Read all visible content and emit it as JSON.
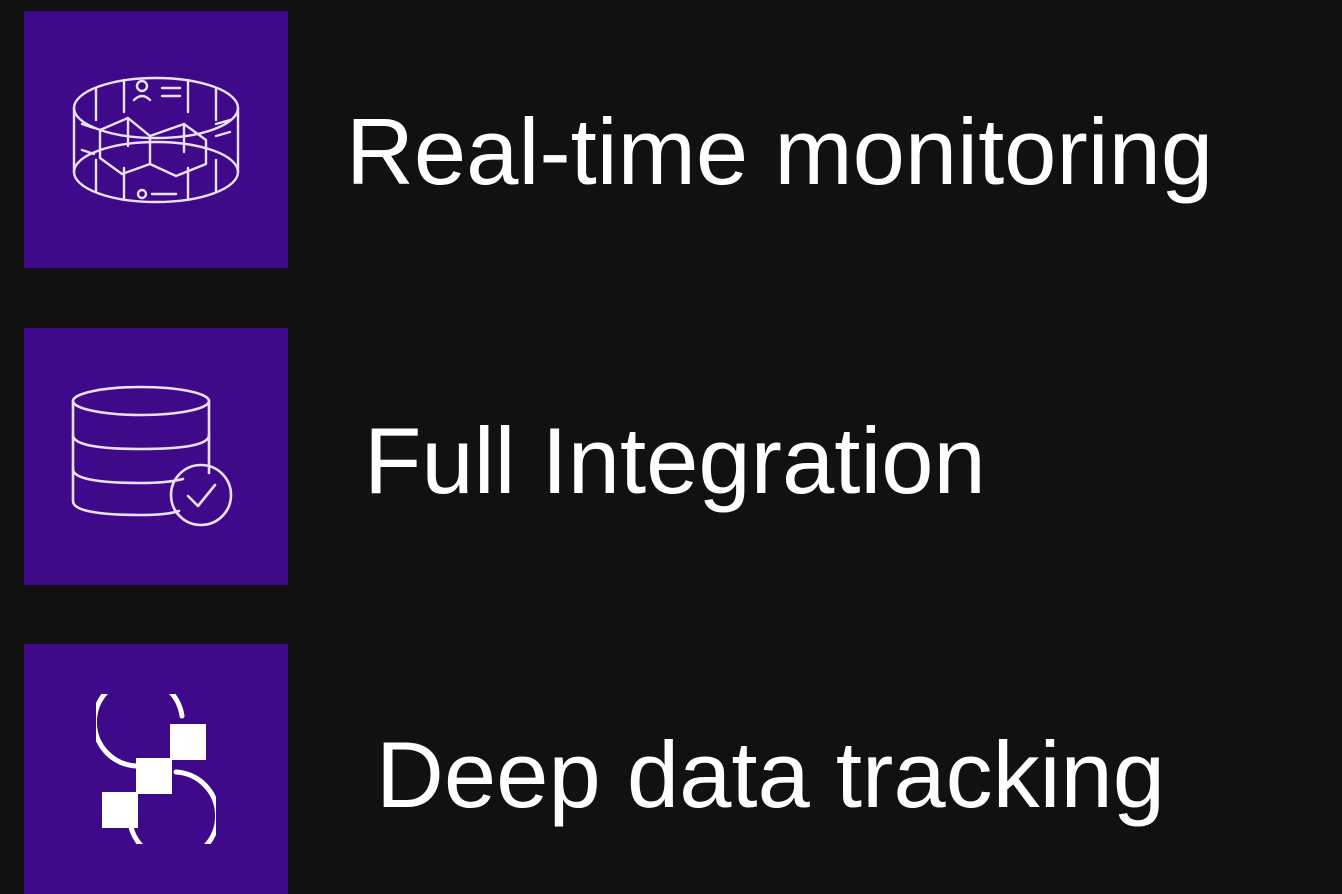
{
  "features": [
    {
      "icon": "monitoring-ring-icon",
      "label": "Real-time monitoring"
    },
    {
      "icon": "database-check-icon",
      "label": "Full Integration"
    },
    {
      "icon": "data-tracking-s-icon",
      "label": "Deep data tracking"
    }
  ],
  "colors": {
    "background": "#111111",
    "tile": "#3f0a8a",
    "text": "#ffffff"
  }
}
